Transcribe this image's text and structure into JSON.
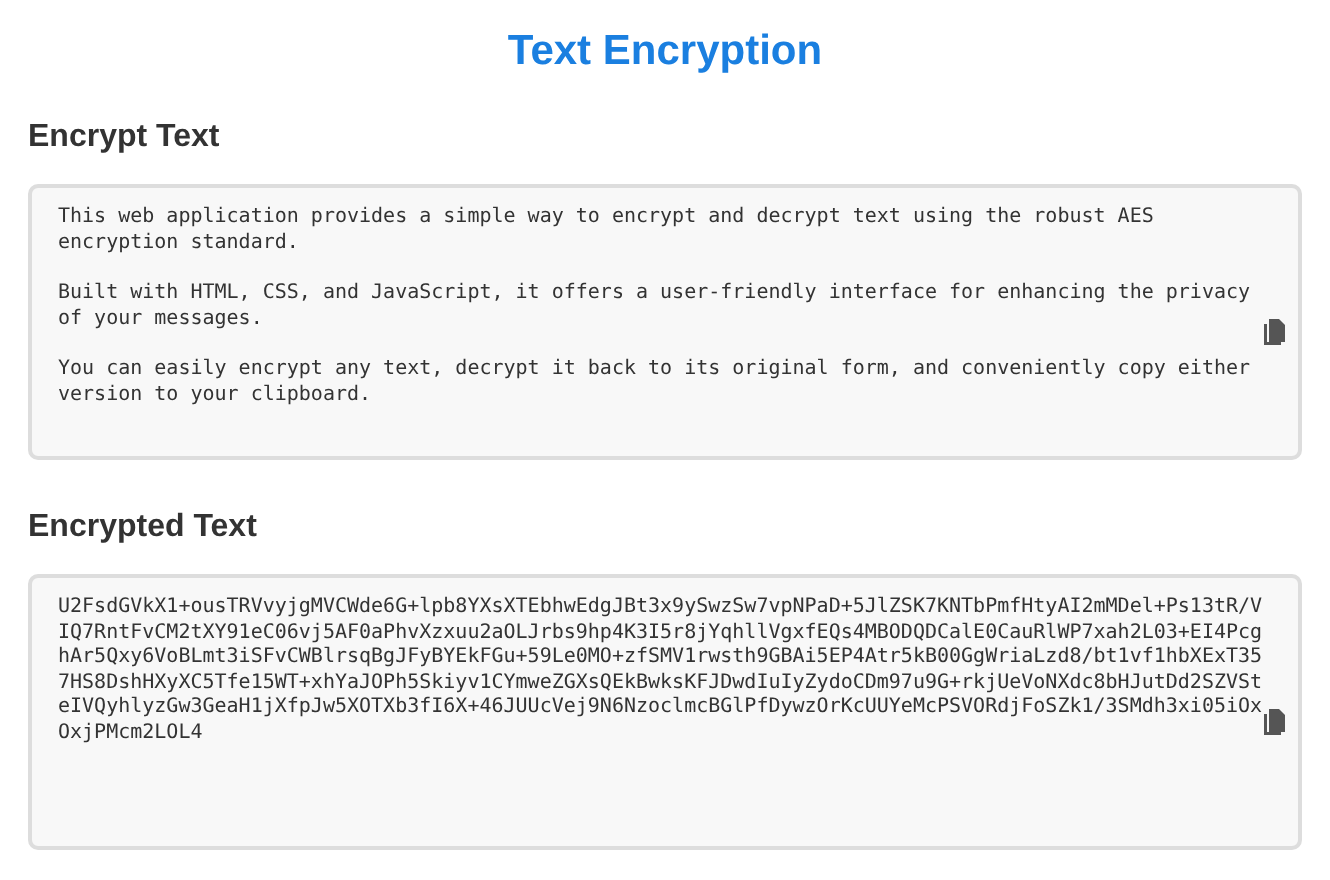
{
  "title": "Text Encryption",
  "sections": [
    {
      "heading": "Encrypt Text",
      "kind": "paragraphs",
      "paragraphs": [
        "This web application provides a simple way to encrypt and decrypt text using the robust AES encryption standard.",
        "Built with HTML, CSS, and JavaScript, it offers a user-friendly interface for enhancing the privacy of your messages.",
        "You can easily encrypt any text, decrypt it back to its original form, and conveniently copy either version to your clipboard."
      ]
    },
    {
      "heading": "Encrypted Text",
      "kind": "cipher",
      "value": "U2FsdGVkX1+ousTRVvyjgMVCWde6G+lpb8YXsXTEbhwEdgJBt3x9ySwzSw7vpNPaD+5JlZSK7KNTbPmfHtyAI2mMDel+Ps13tR/VIQ7RntFvCM2tXY91eC06vj5AF0aPhvXzxuu2aOLJrbs9hp4K3I5r8jYqhllVgxfEQs4MBODQDCalE0CauRlWP7xah2L03+EI4PcghAr5Qxy6VoBLmt3iSFvCWBlrsqBgJFyBYEkFGu+59Le0MO+zfSMV1rwsth9GBAi5EP4Atr5kB00GgWriaLzd8/bt1vf1hbXExT357HS8DshHXyXC5Tfe15WT+xhYaJOPh5Skiyv1CYmweZGXsQEkBwksKFJDwdIuIyZydoCDm97u9G+rkjUeVoNXdc8bHJutDd2SZVSteIVQyhlyzGw3GeaH1jXfpJw5XOTXb3fI6X+46JUUcVej9N6NzoclmcBGlPfDywzOrKcUUYeMcPSVORdjFoSZk1/3SMdh3xi05iOxOxjPMcm2LOL4"
    }
  ]
}
